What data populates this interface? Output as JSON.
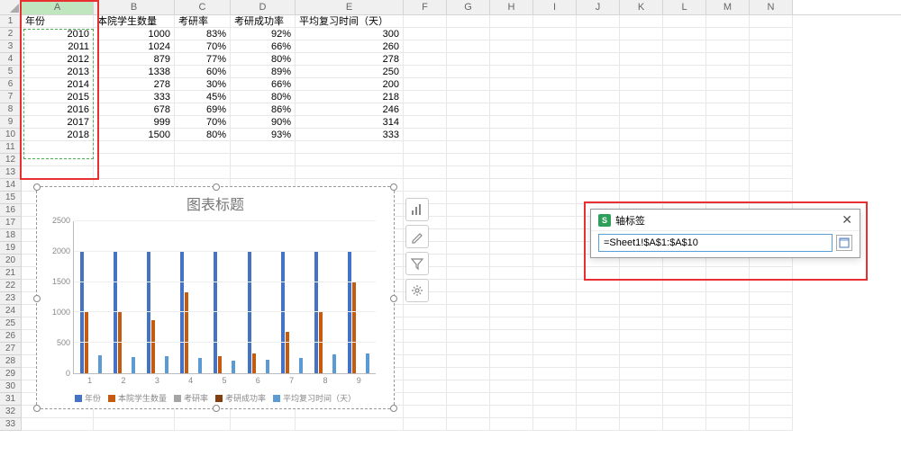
{
  "columns": {
    "letters": [
      "A",
      "B",
      "C",
      "D",
      "E",
      "F",
      "G",
      "H",
      "I",
      "J",
      "K",
      "L",
      "M",
      "N"
    ],
    "widths": [
      80,
      90,
      62,
      72,
      120,
      48,
      48,
      48,
      48,
      48,
      48,
      48,
      48,
      48
    ]
  },
  "rows_visible": 33,
  "headers": [
    "年份",
    "本院学生数量",
    "考研率",
    "考研成功率",
    "平均复习时间（天）"
  ],
  "table": [
    {
      "year": 2010,
      "students": 1000,
      "rate": "83%",
      "success": "92%",
      "days": 300
    },
    {
      "year": 2011,
      "students": 1024,
      "rate": "70%",
      "success": "66%",
      "days": 260
    },
    {
      "year": 2012,
      "students": 879,
      "rate": "77%",
      "success": "80%",
      "days": 278
    },
    {
      "year": 2013,
      "students": 1338,
      "rate": "60%",
      "success": "89%",
      "days": 250
    },
    {
      "year": 2014,
      "students": 278,
      "rate": "30%",
      "success": "66%",
      "days": 200
    },
    {
      "year": 2015,
      "students": 333,
      "rate": "45%",
      "success": "80%",
      "days": 218
    },
    {
      "year": 2016,
      "students": 678,
      "rate": "69%",
      "success": "86%",
      "days": 246
    },
    {
      "year": 2017,
      "students": 999,
      "rate": "70%",
      "success": "90%",
      "days": 314
    },
    {
      "year": 2018,
      "students": 1500,
      "rate": "80%",
      "success": "93%",
      "days": 333
    }
  ],
  "chart_data": {
    "type": "bar",
    "title": "图表标题",
    "categories": [
      "1",
      "2",
      "3",
      "4",
      "5",
      "6",
      "7",
      "8",
      "9"
    ],
    "series": [
      {
        "name": "年份",
        "color": "#4472c4",
        "values": [
          2010,
          2011,
          2012,
          2013,
          2014,
          2015,
          2016,
          2017,
          2018
        ]
      },
      {
        "name": "本院学生数量",
        "color": "#c55a11",
        "values": [
          1000,
          1024,
          879,
          1338,
          278,
          333,
          678,
          999,
          1500
        ]
      },
      {
        "name": "考研率",
        "color": "#a5a5a5",
        "values": [
          0.83,
          0.7,
          0.77,
          0.6,
          0.3,
          0.45,
          0.69,
          0.7,
          0.8
        ]
      },
      {
        "name": "考研成功率",
        "color": "#843c0c",
        "values": [
          0.92,
          0.66,
          0.8,
          0.89,
          0.66,
          0.8,
          0.86,
          0.9,
          0.93
        ]
      },
      {
        "name": "平均复习时间（天）",
        "color": "#5b9bd5",
        "values": [
          300,
          260,
          278,
          250,
          200,
          218,
          246,
          314,
          333
        ]
      }
    ],
    "ylim": [
      0,
      2500
    ],
    "yticks": [
      "0",
      "500",
      "1000",
      "1500",
      "2000",
      "2500"
    ]
  },
  "dialog": {
    "title": "轴标签",
    "formula": "=Sheet1!$A$1:$A$10"
  }
}
